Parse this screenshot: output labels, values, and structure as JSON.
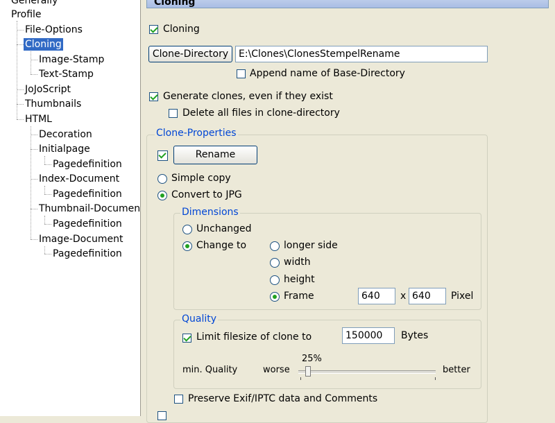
{
  "tree": {
    "items": [
      {
        "label": "Generally"
      },
      {
        "label": "Profile"
      },
      {
        "label": "File-Options"
      },
      {
        "label": "Cloning"
      },
      {
        "label": "Image-Stamp"
      },
      {
        "label": "Text-Stamp"
      },
      {
        "label": "JoJoScript"
      },
      {
        "label": "Thumbnails"
      },
      {
        "label": "HTML"
      },
      {
        "label": "Decoration"
      },
      {
        "label": "Initialpage"
      },
      {
        "label": "Pagedefinition"
      },
      {
        "label": "Index-Document"
      },
      {
        "label": "Pagedefinition"
      },
      {
        "label": "Thumbnail-Document"
      },
      {
        "label": "Pagedefinition"
      },
      {
        "label": "Image-Document"
      },
      {
        "label": "Pagedefinition"
      }
    ],
    "selected": "Cloning"
  },
  "panel": {
    "header": "Cloning",
    "cloning_label": "Cloning",
    "clone_directory_button": "Clone-Directory",
    "clone_directory_value": "E:\\Clones\\ClonesStempelRename",
    "append_name_label": "Append name of Base-Directory",
    "generate_clones_label": "Generate clones, even if they exist",
    "delete_all_label": "Delete all files in clone-directory",
    "clone_properties": {
      "title": "Clone-Properties",
      "rename_button": "Rename",
      "simple_copy": "Simple copy",
      "convert_jpg": "Convert to JPG",
      "dimensions": {
        "title": "Dimensions",
        "unchanged": "Unchanged",
        "change_to": "Change to",
        "longer_side": "longer side",
        "width": "width",
        "height": "height",
        "frame": "Frame",
        "frame_w": "640",
        "x_sep": "x",
        "frame_h": "640",
        "unit": "Pixel"
      },
      "quality": {
        "title": "Quality",
        "limit_label": "Limit filesize of clone to",
        "limit_value": "150000",
        "unit": "Bytes",
        "min_quality": "min. Quality",
        "worse": "worse",
        "better": "better",
        "percent": "25%"
      },
      "preserve_exif": "Preserve Exif/IPTC data and Comments"
    }
  },
  "colors": {
    "selection": "#316ac5",
    "group_label": "#0046d5",
    "check": "#21a121"
  },
  "state": {
    "cloning_checked": true,
    "append_name_checked": false,
    "generate_clones_checked": true,
    "delete_all_checked": false,
    "rename_checked": true,
    "copy_mode": "Convert to JPG",
    "dimension_mode": "Change to",
    "change_to_mode": "Frame",
    "limit_filesize_checked": true,
    "slider_value": 25,
    "preserve_exif_checked": false
  }
}
